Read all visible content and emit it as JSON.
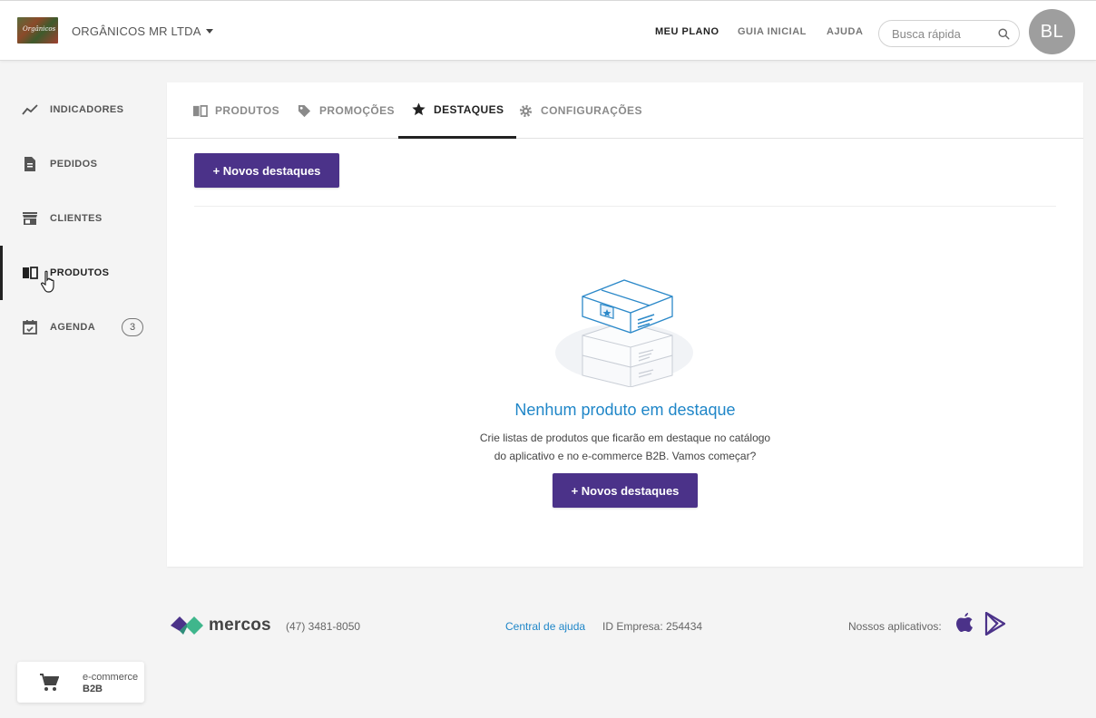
{
  "header": {
    "logo_text": "Orgânicos",
    "company_name": "ORGÂNICOS MR LTDA",
    "nav": [
      {
        "label": "MEU PLANO",
        "active": true
      },
      {
        "label": "GUIA INICIAL",
        "active": false
      },
      {
        "label": "AJUDA",
        "active": false
      }
    ],
    "search_placeholder": "Busca rápida",
    "avatar_initials": "BL"
  },
  "sidebar": {
    "items": [
      {
        "label": "INDICADORES",
        "icon": "chart-line-icon"
      },
      {
        "label": "PEDIDOS",
        "icon": "document-icon"
      },
      {
        "label": "CLIENTES",
        "icon": "store-icon"
      },
      {
        "label": "PRODUTOS",
        "icon": "book-icon",
        "active": true
      },
      {
        "label": "AGENDA",
        "icon": "calendar-check-icon",
        "badge": "3"
      }
    ]
  },
  "tabs": [
    {
      "label": "PRODUTOS",
      "icon": "book-icon"
    },
    {
      "label": "PROMOÇÕES",
      "icon": "tag-icon"
    },
    {
      "label": "DESTAQUES",
      "icon": "star-icon",
      "active": true
    },
    {
      "label": "CONFIGURAÇÕES",
      "icon": "gear-icon"
    }
  ],
  "main": {
    "new_button_label": "+ Novos destaques",
    "empty_title": "Nenhum produto em destaque",
    "empty_line1": "Crie listas de produtos que ficarão em destaque no catálogo",
    "empty_line2": "do aplicativo e no e-commerce B2B. Vamos começar?",
    "empty_button_label": "+ Novos destaques"
  },
  "footer": {
    "brand": "mercos",
    "phone": "(47) 3481-8050",
    "help_link": "Central de ajuda",
    "company_id": "ID Empresa: 254434",
    "apps_label": "Nossos aplicativos:"
  },
  "ecommerce": {
    "line1": "e-commerce",
    "line2": "B2B"
  },
  "colors": {
    "primary_button": "#4b3289",
    "title_blue": "#1f86c8",
    "app_icons": "#4b3289"
  }
}
